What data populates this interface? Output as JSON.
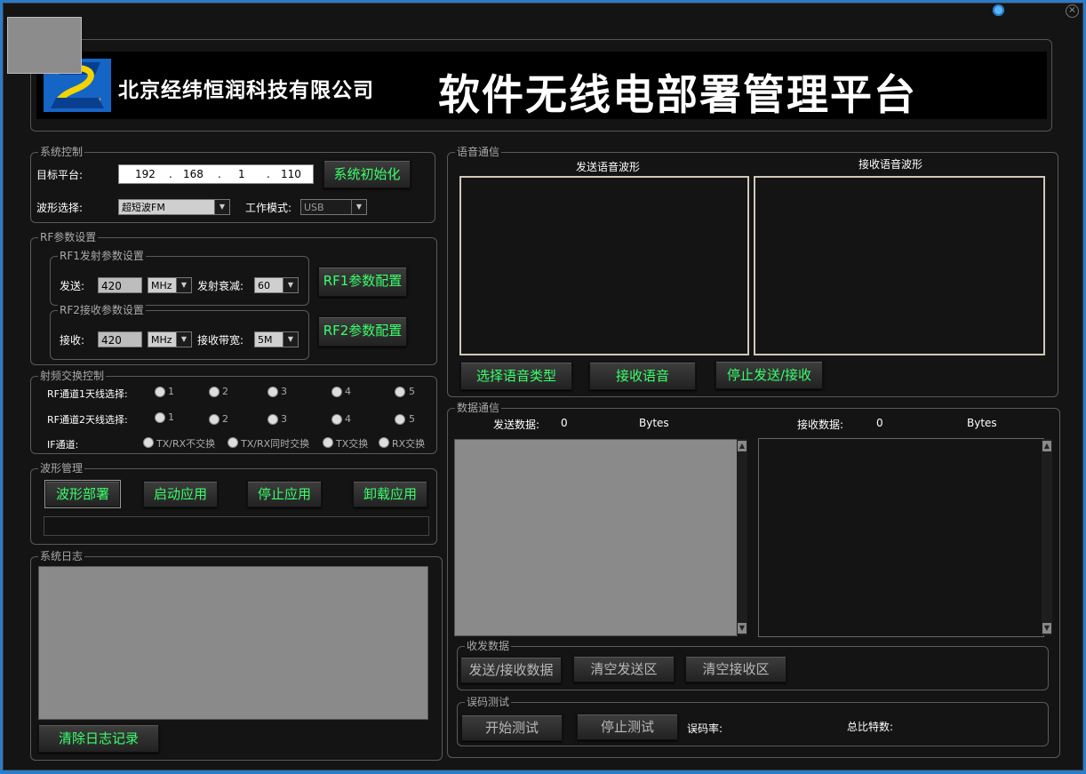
{
  "banner": {
    "company": "北京经纬恒润科技有限公司",
    "title": "软件无线电部署管理平台"
  },
  "sys_ctrl": {
    "legend": "系统控制",
    "target_label": "目标平台:",
    "ip": [
      "192",
      "168",
      "1",
      "110"
    ],
    "init_btn": "系统初始化",
    "wave_label": "波形选择:",
    "wave_value": "超短波FM",
    "mode_label": "工作模式:",
    "mode_value": "USB"
  },
  "rf": {
    "legend": "RF参数设置",
    "rf1_legend": "RF1发射参数设置",
    "send_label": "发送:",
    "send_value": "420",
    "send_unit": "MHz",
    "atten_label": "发射衰减:",
    "atten_value": "60",
    "rf1_btn": "RF1参数配置",
    "rf2_legend": "RF2接收参数设置",
    "recv_label": "接收:",
    "recv_value": "420",
    "recv_unit": "MHz",
    "bw_label": "接收带宽:",
    "bw_value": "5M",
    "rf2_btn": "RF2参数配置"
  },
  "switch": {
    "legend": "射频交换控制",
    "ch1_label": "RF通道1天线选择:",
    "ch2_label": "RF通道2天线选择:",
    "if_label": "IF通道:",
    "antennas": [
      "1",
      "2",
      "3",
      "4",
      "5"
    ],
    "if_options": [
      "TX/RX不交换",
      "TX/RX同时交换",
      "TX交换",
      "RX交换"
    ]
  },
  "wave_mgmt": {
    "legend": "波形管理",
    "deploy": "波形部署",
    "start": "启动应用",
    "stop": "停止应用",
    "unload": "卸载应用",
    "progress": 0
  },
  "log": {
    "legend": "系统日志",
    "clear_btn": "清除日志记录"
  },
  "voice": {
    "legend": "语音通信",
    "send_wave": "发送语音波形",
    "recv_wave": "接收语音波形",
    "select_btn": "选择语音类型",
    "recv_btn": "接收语音",
    "stop_btn": "停止发送/接收"
  },
  "data": {
    "legend": "数据通信",
    "send_label": "发送数据:",
    "send_count": "0",
    "send_unit": "Bytes",
    "recv_label": "接收数据:",
    "recv_count": "0",
    "recv_unit": "Bytes",
    "txrx_legend": "收发数据",
    "txrx_btn": "发送/接收数据",
    "clear_send": "清空发送区",
    "clear_recv": "清空接收区",
    "ber_legend": "误码测试",
    "start_test": "开始测试",
    "stop_test": "停止测试",
    "ber_label": "误码率:",
    "total_bits_label": "总比特数:"
  },
  "colors": {
    "accent_text": "#39ff6a",
    "background": "#141414",
    "titlebar": "#2a7bc8"
  }
}
